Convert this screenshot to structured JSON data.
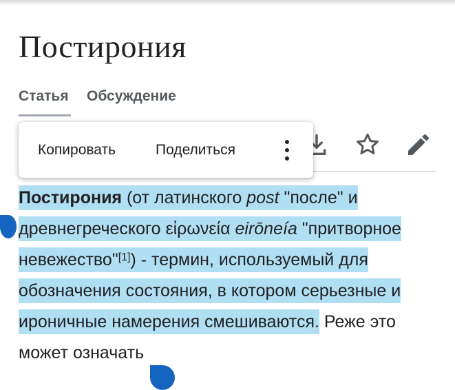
{
  "article": {
    "title": "Постирония"
  },
  "tabs": {
    "article": "Статья",
    "talk": "Обсуждение"
  },
  "toolbar": {
    "icons": [
      "download-icon",
      "star-icon",
      "edit-icon"
    ]
  },
  "selection_menu": {
    "copy": "Копировать",
    "share": "Поделиться",
    "more_icon": "more-vertical-icon"
  },
  "content": {
    "term": "Постирония",
    "t1": " (от латинского ",
    "post": "post",
    "t2": " \"после\" и древнегреческого ",
    "greek": "εἰρωνεία",
    "t3": " ",
    "translit": "eirōneía",
    "t4": " \"притворное невежество\"",
    "ref": "[1]",
    "t5": ") - термин, используемый для обозначения состояния, в котором серьезные и ироничные намерения смешиваются.",
    "t6": " Реже это может означать"
  },
  "colors": {
    "selection": "#b0dff4",
    "handle": "#1565c0"
  }
}
